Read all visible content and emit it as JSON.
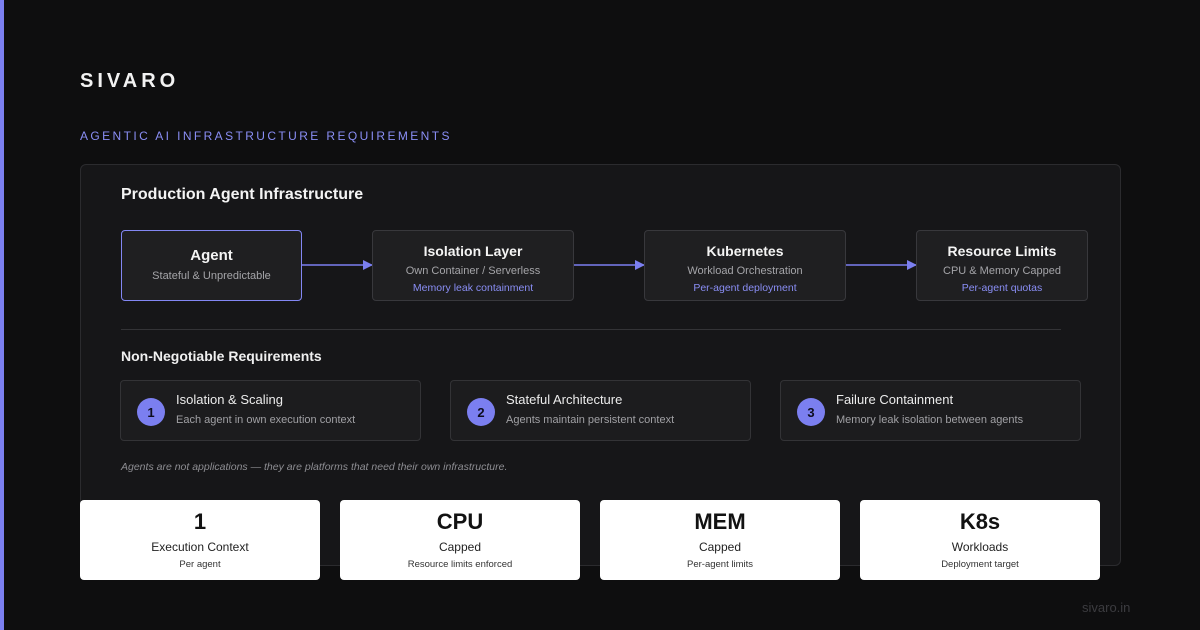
{
  "brand": "SIVARO",
  "subtitle": "AGENTIC AI INFRASTRUCTURE REQUIREMENTS",
  "panel": {
    "title": "Production Agent Infrastructure",
    "nodes": [
      {
        "title": "Agent",
        "desc": "Stateful & Unpredictable",
        "note": ""
      },
      {
        "title": "Isolation Layer",
        "desc": "Own Container / Serverless",
        "note": "Memory leak containment"
      },
      {
        "title": "Kubernetes",
        "desc": "Workload Orchestration",
        "note": "Per-agent deployment"
      },
      {
        "title": "Resource Limits",
        "desc": "CPU & Memory Capped",
        "note": "Per-agent quotas"
      }
    ],
    "requirements_title": "Non-Negotiable Requirements",
    "requirements": [
      {
        "num": "1",
        "name": "Isolation & Scaling",
        "desc": "Each agent in own execution context"
      },
      {
        "num": "2",
        "name": "Stateful Architecture",
        "desc": "Agents maintain persistent context"
      },
      {
        "num": "3",
        "name": "Failure Containment",
        "desc": "Memory leak isolation between agents"
      }
    ],
    "quote": "Agents are not applications — they are platforms that need their own infrastructure."
  },
  "stats": [
    {
      "value": "1",
      "label": "Execution Context",
      "sub": "Per agent"
    },
    {
      "value": "CPU",
      "label": "Capped",
      "sub": "Resource limits enforced"
    },
    {
      "value": "MEM",
      "label": "Capped",
      "sub": "Per-agent limits"
    },
    {
      "value": "K8s",
      "label": "Workloads",
      "sub": "Deployment target"
    }
  ],
  "footer": "sivaro.in",
  "colors": {
    "accent": "#7b7ff0",
    "background": "#0e0e0f",
    "panel": "#161618"
  }
}
